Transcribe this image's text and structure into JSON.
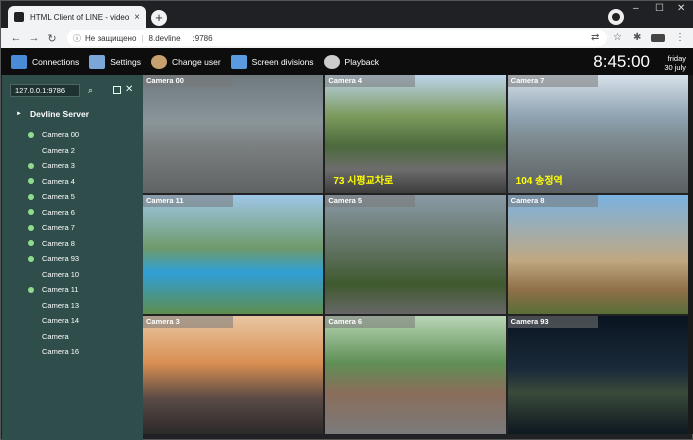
{
  "browser": {
    "tab_title": "HTML Client of LINE - video surv...",
    "tab_close": "×",
    "new_tab": "+",
    "nav": {
      "back": "←",
      "forward": "→",
      "reload": "↻"
    },
    "omnibox": {
      "security_icon": "ⓘ",
      "security_text": "Не защищено",
      "host": "8.devline",
      "port": ":9786"
    },
    "window_controls": {
      "minimize": "–",
      "maximize": "☐",
      "close": "✕"
    },
    "toolbar_icons": {
      "translate": "⇄",
      "star": "☆",
      "extensions": "✱",
      "menu": "⋮"
    }
  },
  "app": {
    "menu": [
      {
        "label": "Connections",
        "icon": "connections-icon"
      },
      {
        "label": "Settings",
        "icon": "settings-icon"
      },
      {
        "label": "Change user",
        "icon": "user-icon"
      },
      {
        "label": "Screen divisions",
        "icon": "grid-icon"
      },
      {
        "label": "Playback",
        "icon": "film-reel-icon"
      }
    ],
    "clock": "8:45:00",
    "date_day": "friday",
    "date_date": "30 july"
  },
  "sidebar": {
    "search_value": "127.0.0.1:9786",
    "server_name": "Devline Server",
    "cameras": [
      {
        "name": "Camera 00",
        "online": true
      },
      {
        "name": "Camera 2",
        "online": false
      },
      {
        "name": "Camera 3",
        "online": true
      },
      {
        "name": "Camera 4",
        "online": true
      },
      {
        "name": "Camera 5",
        "online": true
      },
      {
        "name": "Camera 6",
        "online": true
      },
      {
        "name": "Camera 7",
        "online": true
      },
      {
        "name": "Camera 8",
        "online": true
      },
      {
        "name": "Camera 93",
        "online": true
      },
      {
        "name": "Camera 10",
        "online": false
      },
      {
        "name": "Camera 11",
        "online": true
      },
      {
        "name": "Camera 13",
        "online": false
      },
      {
        "name": "Camera 14",
        "online": false
      },
      {
        "name": "Camera",
        "online": false
      },
      {
        "name": "Camera 16",
        "online": false
      }
    ]
  },
  "grid": {
    "cells": [
      {
        "label": "Camera 00",
        "overlay": ""
      },
      {
        "label": "Camera 4",
        "overlay": "73  시평교차로"
      },
      {
        "label": "Camera 7",
        "overlay": "104  송정역"
      },
      {
        "label": "Camera 11",
        "overlay": ""
      },
      {
        "label": "Camera 5",
        "overlay": ""
      },
      {
        "label": "Camera 8",
        "overlay": ""
      },
      {
        "label": "Camera 3",
        "overlay": ""
      },
      {
        "label": "Camera 6",
        "overlay": ""
      },
      {
        "label": "Camera 93",
        "overlay": ""
      }
    ]
  },
  "colors": {
    "sidebar_bg": "#2f4d4b",
    "online_dot": "#8fdc8f",
    "header_bg": "#0d0d0d"
  }
}
